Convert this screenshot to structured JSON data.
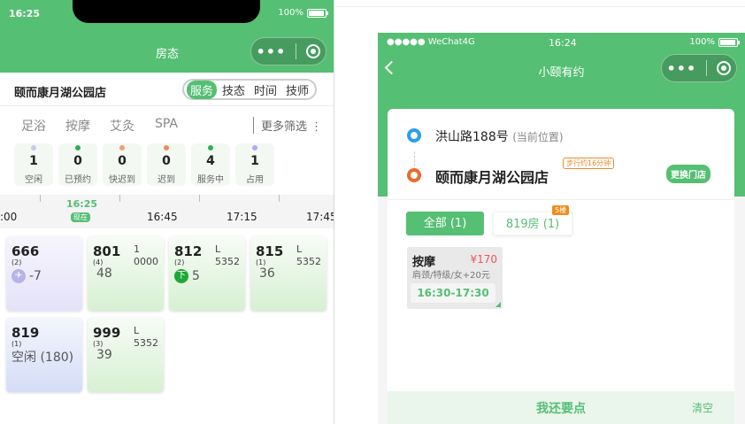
{
  "left": {
    "status_time": "16:25",
    "battery": "100%",
    "title": "房态",
    "store_name": "颐而康月湖公园店",
    "segments": [
      "服务",
      "技态",
      "时间",
      "技师"
    ],
    "categories": [
      "足浴",
      "按摩",
      "艾灸",
      "SPA"
    ],
    "more_filter": "更多筛选 ⋮",
    "stats": [
      {
        "num": "1",
        "label": "空闲",
        "color": "#c9c9f2"
      },
      {
        "num": "0",
        "label": "已预约",
        "color": "#2bb24c"
      },
      {
        "num": "0",
        "label": "快迟到",
        "color": "#f0a070"
      },
      {
        "num": "0",
        "label": "迟到",
        "color": "#f08a5a"
      },
      {
        "num": "4",
        "label": "服务中",
        "color": "#2bb24c"
      },
      {
        "num": "1",
        "label": "占用",
        "color": "#b9a6ee"
      }
    ],
    "timeline": {
      "labels": [
        ":00",
        "16:45",
        "17:15",
        "17:45"
      ],
      "now_time": "16:25",
      "now_tag": "现在"
    },
    "rooms": [
      {
        "num": "666",
        "count": "(2)",
        "value": "-7",
        "icon": "plane-icon",
        "bg": "#ecebfb"
      },
      {
        "num": "801",
        "count": "(4)",
        "line_a": "1",
        "line_b": "0000",
        "value": "48",
        "bg": "#e3f4e2"
      },
      {
        "num": "812",
        "count": "(2)",
        "line_a": "L",
        "line_b": "5352",
        "value": "5",
        "badge": "下",
        "bg": "#e3f4e2"
      },
      {
        "num": "815",
        "count": "(1)",
        "line_a": "L",
        "line_b": "5352",
        "value": "36",
        "bg": "#e3f4e2"
      },
      {
        "num": "819",
        "count": "(1)",
        "value": "空闲 (180)",
        "bg": "#e4eafb"
      },
      {
        "num": "999",
        "count": "(3)",
        "line_a": "L",
        "line_b": "5352",
        "value": "39",
        "bg": "#e3f4e2"
      }
    ]
  },
  "right": {
    "carrier": "●●●●● WeChat4G",
    "status_time": "16:24",
    "battery": "100%",
    "title": "小颐有约",
    "location": "洪山路188号",
    "location_tag": "(当前位置)",
    "store_name": "颐而康月湖公园店",
    "walk_tag": "步行约16分钟",
    "change_store": "更换门店",
    "tab_all": "全部 (1)",
    "tab_room": "819房 (1)",
    "floor_tag": "5楼",
    "service": {
      "name": "按摩",
      "price": "¥170",
      "desc": "肩颈/特级/女+20元",
      "time": "16:30-17:30"
    },
    "more_button": "我还要点",
    "clear_button": "清空"
  },
  "colors": {
    "brand_green": "#55bf73",
    "price_red": "#e55555",
    "floor_orange": "#f08d1a"
  }
}
